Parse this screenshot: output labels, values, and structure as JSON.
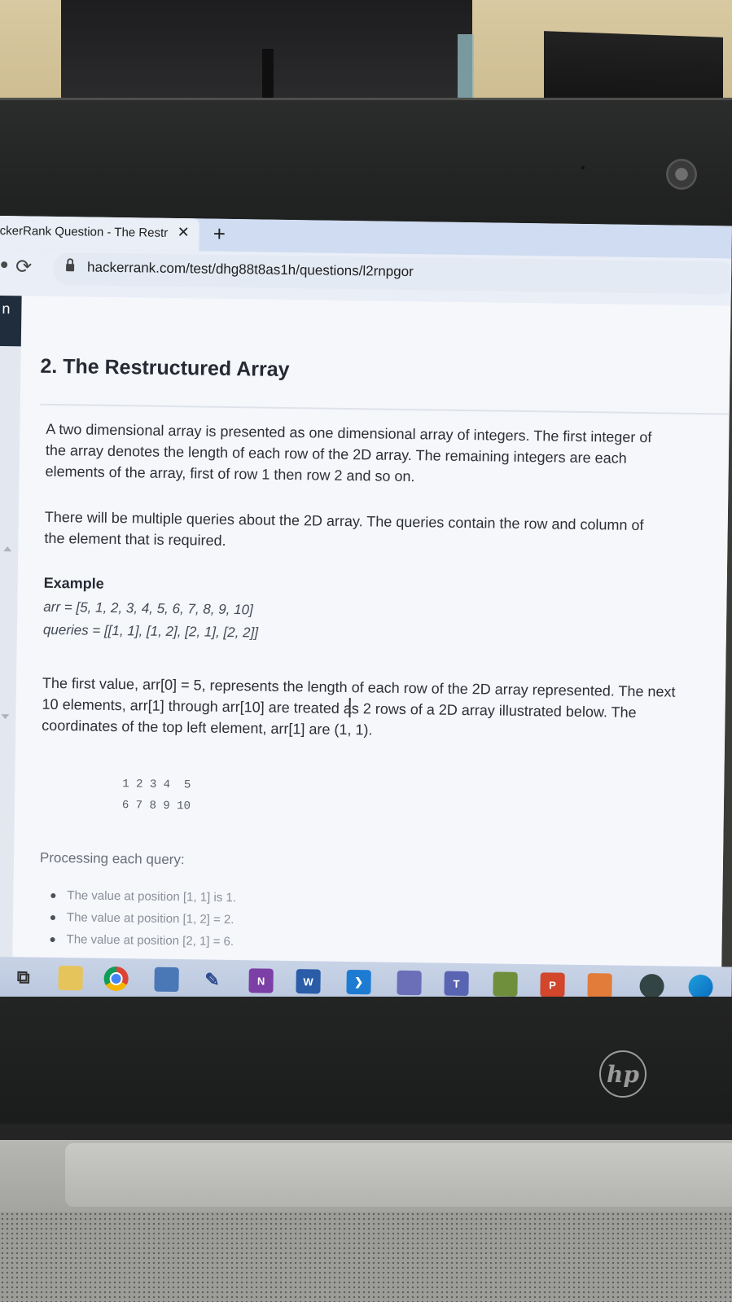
{
  "browser": {
    "tab_title": "ckerRank Question - The Restr",
    "tab_close": "✕",
    "new_tab": "+",
    "reload_icon": "⟳",
    "url": "hackerrank.com/test/dhg88t8as1h/questions/l2rnpgor"
  },
  "left_rail": {
    "letter": "n"
  },
  "question": {
    "title": "2. The Restructured Array",
    "paragraph1": "A two dimensional array is presented as one dimensional array of integers. The first integer of the array denotes the length of each row of the 2D array. The remaining integers are each elements of the array, first of row 1 then row 2 and so on.",
    "paragraph2": "There will be multiple queries about the 2D array. The queries contain the row and column of the element that is required.",
    "example_label": "Example",
    "arr_line": "arr = [5, 1, 2, 3, 4, 5, 6, 7, 8, 9, 10]",
    "queries_line": "queries = [[1, 1], [1, 2], [2, 1], [2, 2]]",
    "paragraph3": "The first value, arr[0] = 5, represents the length of each row of the 2D array represented. The next 10 elements, arr[1] through arr[10] are treated as 2 rows of a 2D array illustrated below. The coordinates of the top left element, arr[1] are (1, 1).",
    "matrix_row1": "1 2 3 4  5",
    "matrix_row2": "6 7 8 9 10",
    "processing_label": "Processing each query:",
    "bullets": [
      "The value at position [1, 1] is 1.",
      "The value at position [1, 2] = 2.",
      "The value at position [2, 1] = 6."
    ]
  },
  "taskbar": {
    "task_view_icon": "⧉",
    "onenote_label": "N",
    "word_label": "W",
    "teams_label": "T",
    "ppt_label": "P"
  },
  "laptop": {
    "brand_logo": "hp"
  }
}
